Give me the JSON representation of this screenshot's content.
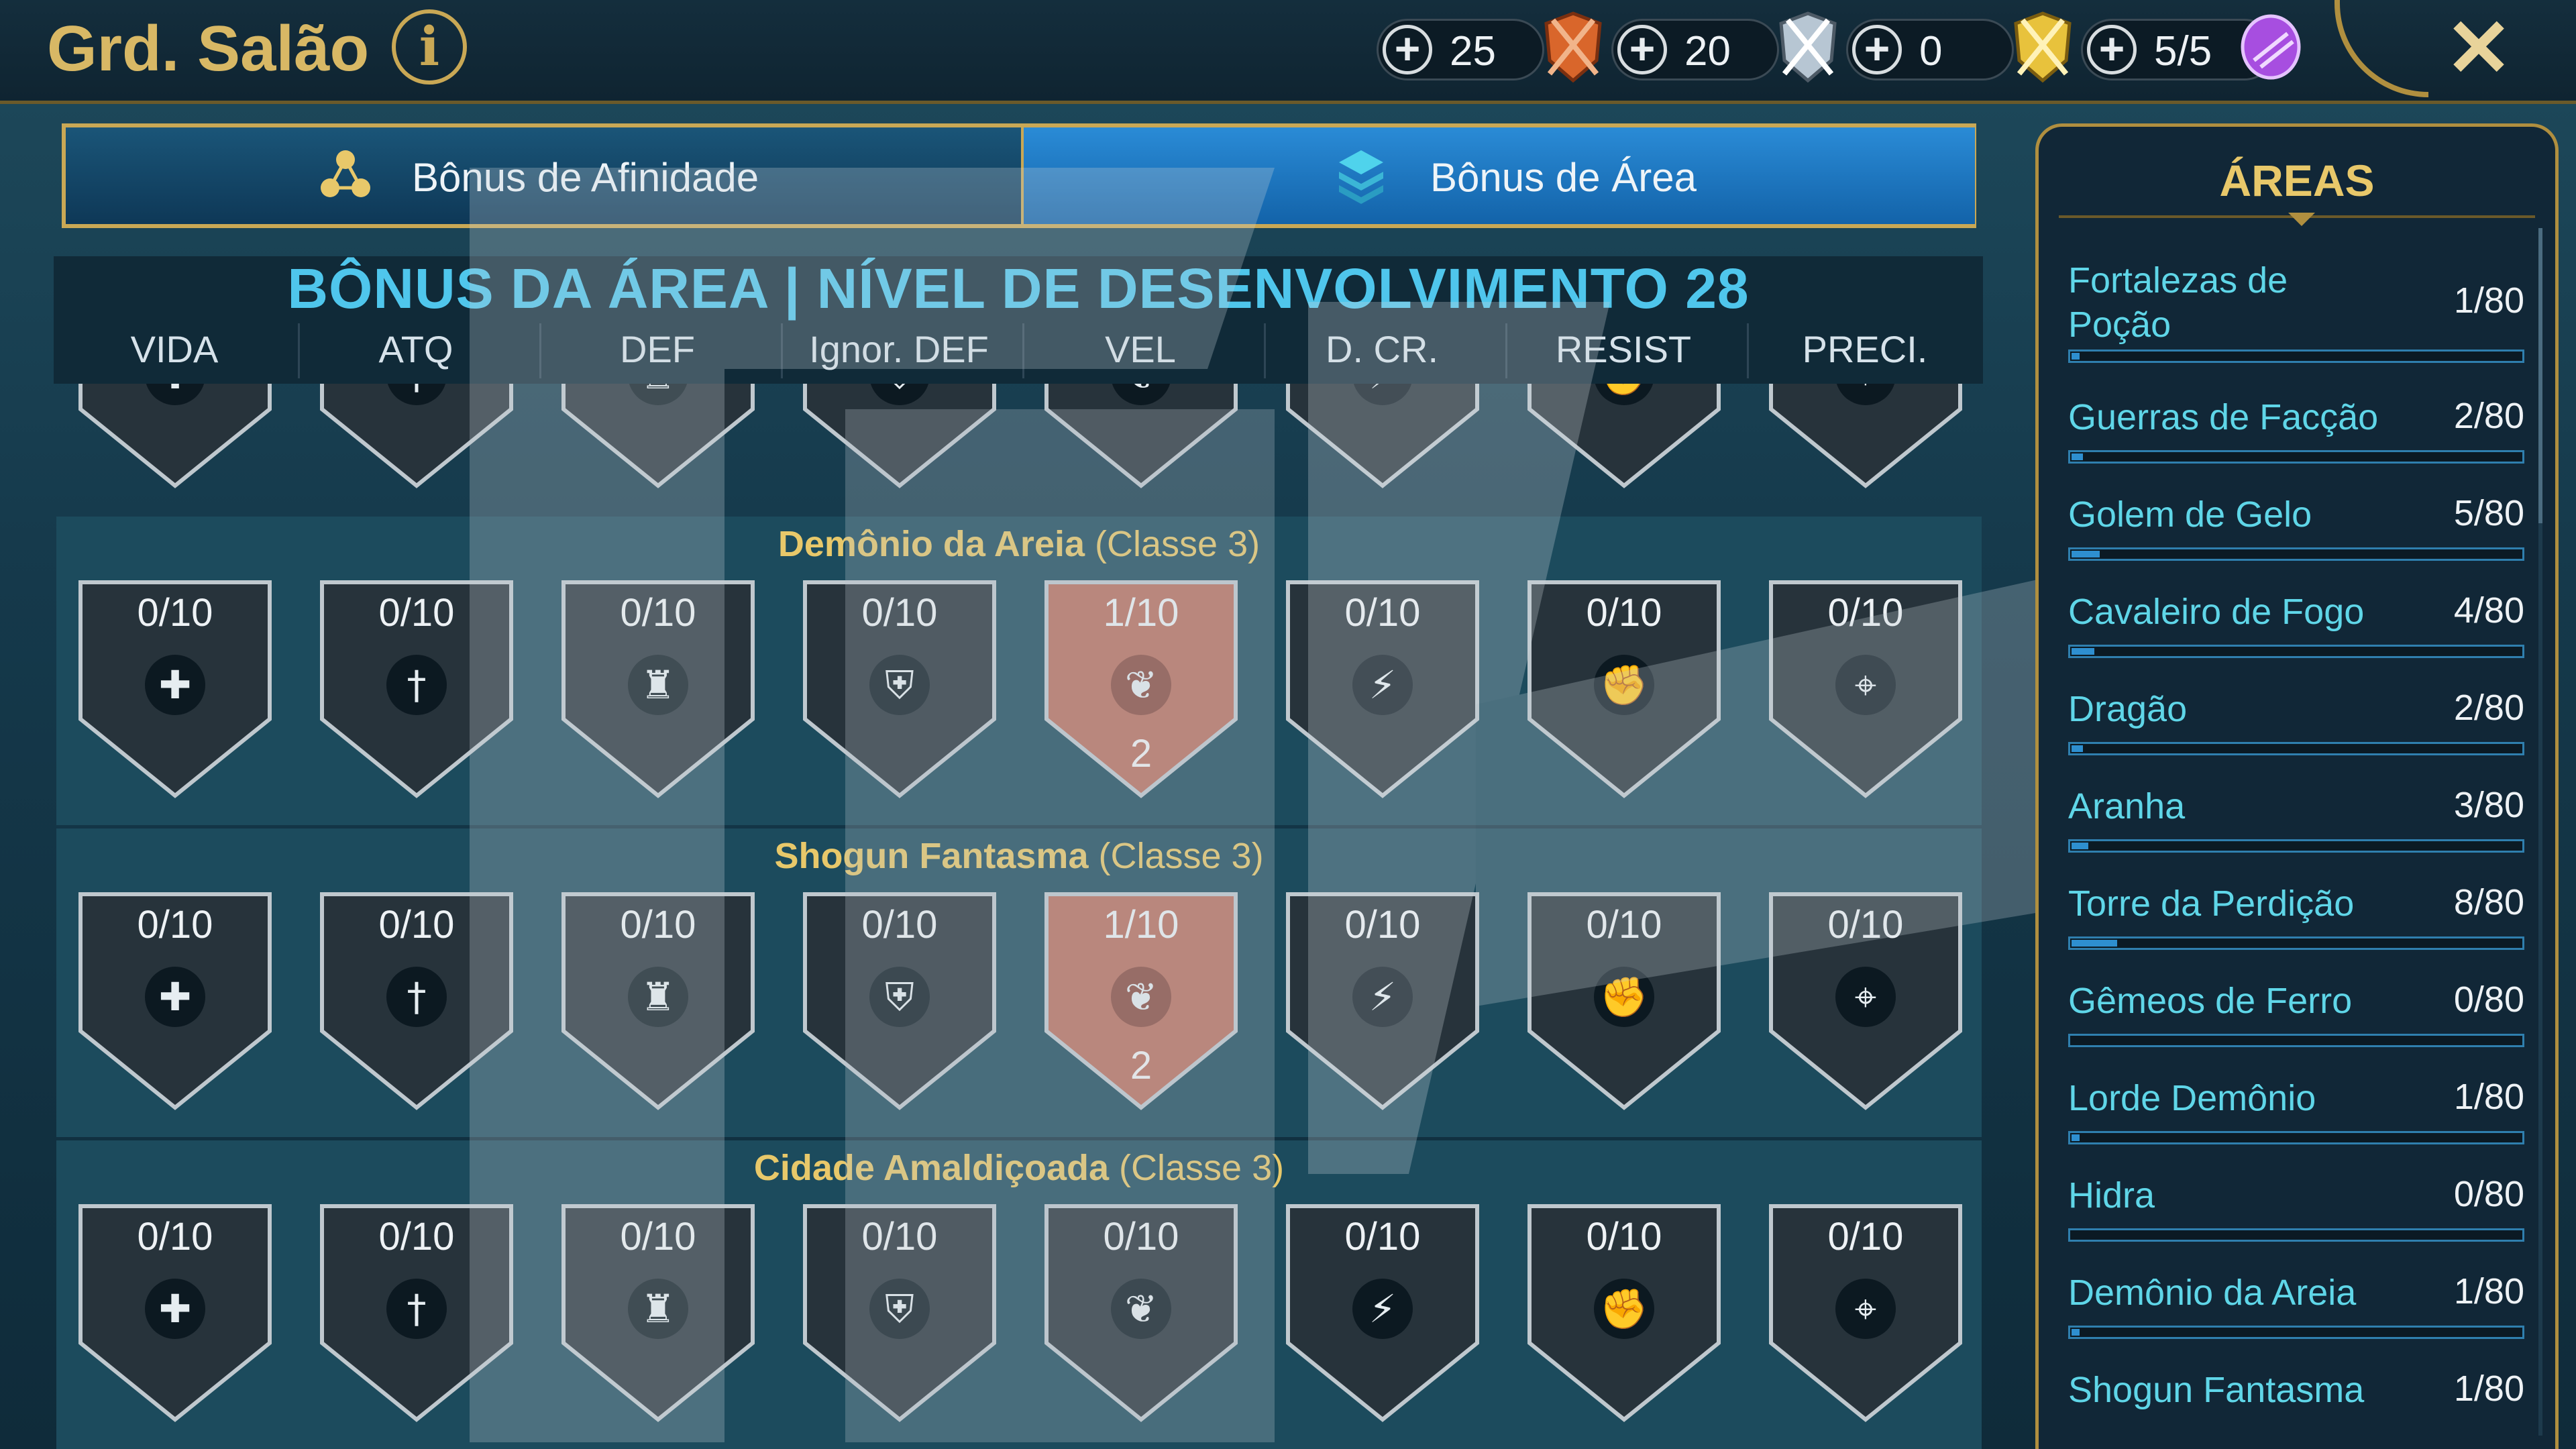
{
  "header": {
    "title": "Grd. Salão",
    "info_icon": "info-icon",
    "resources": [
      {
        "value": "25",
        "icon": "bronze-medal-icon",
        "color": "#d9662b"
      },
      {
        "value": "20",
        "icon": "silver-medal-icon",
        "color": "#b7c6d3"
      },
      {
        "value": "0",
        "icon": "gold-medal-icon",
        "color": "#e8c23c"
      },
      {
        "value": "5/5",
        "icon": "purple-gem-icon",
        "color": "#a74ee0"
      }
    ],
    "close_icon": "close-icon"
  },
  "tabs": [
    {
      "label": "Bônus de Afinidade",
      "icon": "affinity-icon",
      "selected": false
    },
    {
      "label": "Bônus de Área",
      "icon": "area-layers-icon",
      "selected": true
    }
  ],
  "main": {
    "title": "BÔNUS DA ÁREA | NÍVEL DE DESENVOLVIMENTO 28",
    "stat_headers": [
      "VIDA",
      "ATQ",
      "DEF",
      "Ignor. DEF",
      "VEL",
      "D. CR.",
      "RESIST",
      "PRECI."
    ],
    "stat_icons": [
      "health-icon",
      "sword-icon",
      "tower-icon",
      "armor-icon",
      "wing-icon",
      "lightning-icon",
      "fist-icon",
      "crosshair-icon"
    ],
    "zones": [
      {
        "name": "Demônio da Areia",
        "class_label": "(Classe 3)",
        "cells": [
          {
            "count": "0/10",
            "bonus": ""
          },
          {
            "count": "0/10",
            "bonus": ""
          },
          {
            "count": "0/10",
            "bonus": ""
          },
          {
            "count": "0/10",
            "bonus": ""
          },
          {
            "count": "1/10",
            "bonus": "2",
            "active": true
          },
          {
            "count": "0/10",
            "bonus": ""
          },
          {
            "count": "0/10",
            "bonus": ""
          },
          {
            "count": "0/10",
            "bonus": ""
          }
        ]
      },
      {
        "name": "Shogun Fantasma",
        "class_label": "(Classe 3)",
        "cells": [
          {
            "count": "0/10",
            "bonus": ""
          },
          {
            "count": "0/10",
            "bonus": ""
          },
          {
            "count": "0/10",
            "bonus": ""
          },
          {
            "count": "0/10",
            "bonus": ""
          },
          {
            "count": "1/10",
            "bonus": "2",
            "active": true
          },
          {
            "count": "0/10",
            "bonus": ""
          },
          {
            "count": "0/10",
            "bonus": ""
          },
          {
            "count": "0/10",
            "bonus": ""
          }
        ]
      },
      {
        "name": "Cidade Amaldiçoada",
        "class_label": "(Classe 3)",
        "cells": [
          {
            "count": "0/10",
            "bonus": ""
          },
          {
            "count": "0/10",
            "bonus": ""
          },
          {
            "count": "0/10",
            "bonus": ""
          },
          {
            "count": "0/10",
            "bonus": ""
          },
          {
            "count": "0/10",
            "bonus": ""
          },
          {
            "count": "0/10",
            "bonus": ""
          },
          {
            "count": "0/10",
            "bonus": ""
          },
          {
            "count": "0/10",
            "bonus": ""
          }
        ]
      }
    ]
  },
  "sidebar": {
    "title": "ÁREAS",
    "items": [
      {
        "name": "Fortalezas de Poção",
        "progress": "1/80",
        "fraction": 0.0125
      },
      {
        "name": "Guerras de Facção",
        "progress": "2/80",
        "fraction": 0.025
      },
      {
        "name": "Golem de Gelo",
        "progress": "5/80",
        "fraction": 0.0625
      },
      {
        "name": "Cavaleiro de Fogo",
        "progress": "4/80",
        "fraction": 0.05
      },
      {
        "name": "Dragão",
        "progress": "2/80",
        "fraction": 0.025
      },
      {
        "name": "Aranha",
        "progress": "3/80",
        "fraction": 0.0375
      },
      {
        "name": "Torre da Perdição",
        "progress": "8/80",
        "fraction": 0.1
      },
      {
        "name": "Gêmeos de Ferro",
        "progress": "0/80",
        "fraction": 0
      },
      {
        "name": "Lorde Demônio",
        "progress": "1/80",
        "fraction": 0.0125
      },
      {
        "name": "Hidra",
        "progress": "0/80",
        "fraction": 0
      },
      {
        "name": "Demônio da Areia",
        "progress": "1/80",
        "fraction": 0.0125
      },
      {
        "name": "Shogun Fantasma",
        "progress": "1/80",
        "fraction": 0.0125
      }
    ]
  }
}
